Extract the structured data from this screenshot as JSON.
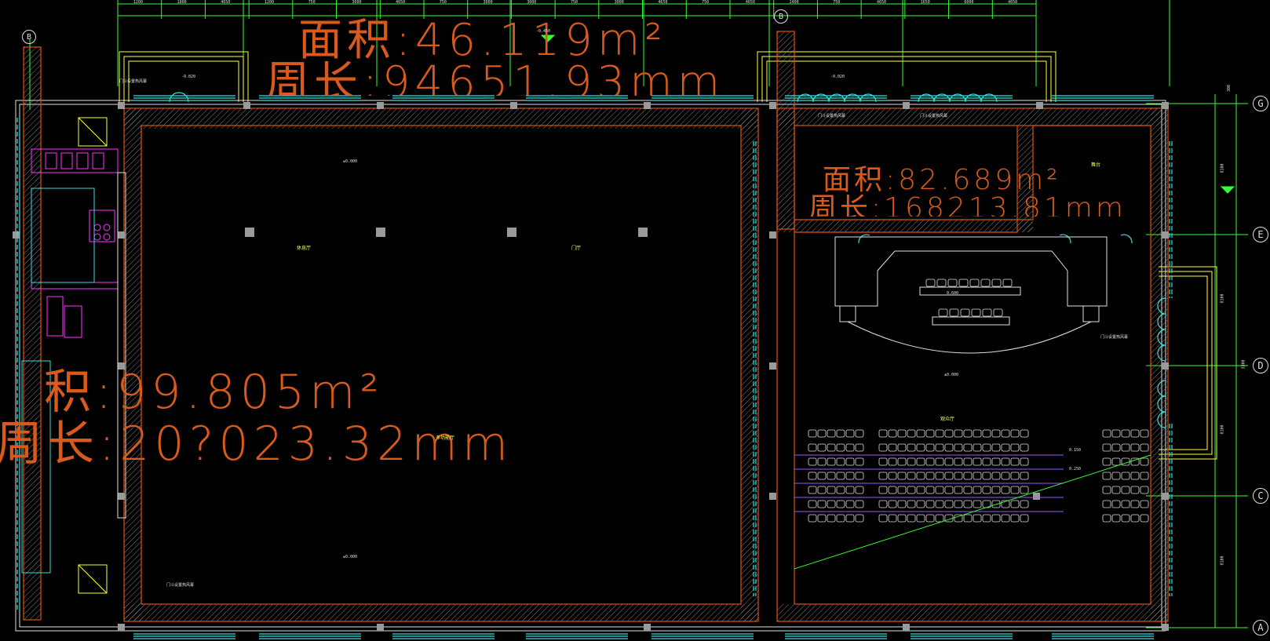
{
  "areas": [
    {
      "area": "面积:46.119m²",
      "perimeter": "周长:94651.93mm"
    },
    {
      "area": "面积:82.689m²",
      "perimeter": "周长:168213.81mm"
    },
    {
      "area": "积:99.805m²",
      "perimeter": "周长:20?023.32mm"
    }
  ],
  "axis_tags": [
    "G",
    "E",
    "D",
    "C",
    "A"
  ],
  "grid_tag_top": "B",
  "levels": [
    "-0.450",
    "-0.020",
    "±0.000",
    "±0.000",
    "±0.000",
    "-0.020",
    "0.600",
    "0.150",
    "0.250"
  ],
  "door_notes": [
    "门斗设置热风幕",
    "门斗设置热风幕",
    "门斗设置热风幕",
    "门斗设置热风幕",
    "门斗设置热风幕"
  ],
  "right_dims": [
    "300",
    "8100",
    "8100",
    "3300",
    "8100",
    "8100"
  ],
  "top_dims": [
    "1200",
    "1800",
    "4650",
    "1200",
    "750",
    "3000",
    "4650",
    "750",
    "3000",
    "3000",
    "750",
    "3000",
    "4650",
    "750",
    "4650",
    "2400",
    "750",
    "4650",
    "1650",
    "6000",
    "4650"
  ],
  "room_labels": [
    "舞台",
    "多功能厅",
    "观众厅",
    "休息厅",
    "门厅"
  ]
}
